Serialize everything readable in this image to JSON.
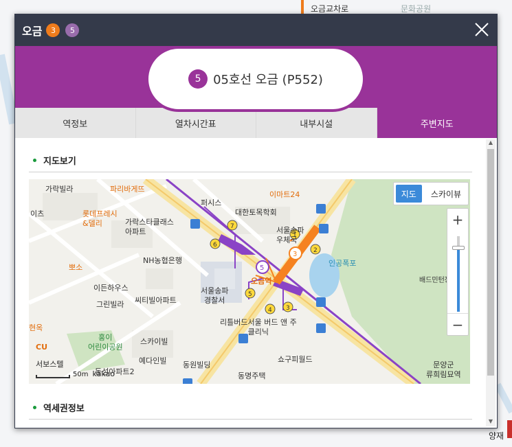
{
  "background": {
    "labels": [
      "오금교차로",
      "문화공원",
      "양재"
    ]
  },
  "popup": {
    "title": "오금",
    "badges": [
      {
        "text": "3",
        "color": "#EF7C1C"
      },
      {
        "text": "5",
        "color": "#996CAC"
      }
    ],
    "close_icon": "close-icon",
    "station_line_number": "5",
    "station_name": "05호선 오금 (P552)",
    "accent_color": "#993399",
    "tabs": [
      "역정보",
      "열차시간표",
      "내부시설",
      "주변지도"
    ],
    "active_tab": "주변지도"
  },
  "map_section": {
    "title": "지도보기",
    "map_type": {
      "map": "지도",
      "skyview": "스카이뷰",
      "selected": "지도"
    },
    "zoom_in": "+",
    "zoom_out": "−",
    "scale": {
      "label": "50m",
      "brand": "kakao"
    },
    "labels": {
      "garak_villa": "가락빌라",
      "paris": "파리바게뜨",
      "perssys": "퍼시스",
      "emart": "이마트24",
      "daehan": "대한토목학회",
      "its": "이츠",
      "lotte": "롯데프레시\n&델리",
      "garak_star": "가락스타클래스\n아파트",
      "seoul_songpa_post": "서울송파\n우체국",
      "nh": "NH농협은행",
      "ppyoso": "뽀소",
      "idenhouse": "이든하우스",
      "city_tower": "씨티빌아파트",
      "green_villa": "그린빌라",
      "police": "서울송파\n경찰서",
      "ogeum_station": "오금역",
      "ingong": "인공폭포",
      "badminton": "배드민턴장",
      "littlebird": "리틀버드서울 버드 앤 주\n클리닉",
      "hong": "홍이\n어린이공원",
      "skyville": "스카이빌",
      "yedain": "예다인빌",
      "dongwon": "동원빌딩",
      "sogupi": "쇼구피월드",
      "dongmyeong": "동명주택",
      "dongsung": "동성아파트2",
      "munyang": "문양군\n류희림묘역",
      "hyeonok": "현옥",
      "cu": "CU",
      "seobo": "서보스텔"
    },
    "exits": [
      "1",
      "2",
      "3",
      "4",
      "5",
      "6",
      "7"
    ]
  },
  "station_area_section": {
    "title": "역세권정보"
  }
}
